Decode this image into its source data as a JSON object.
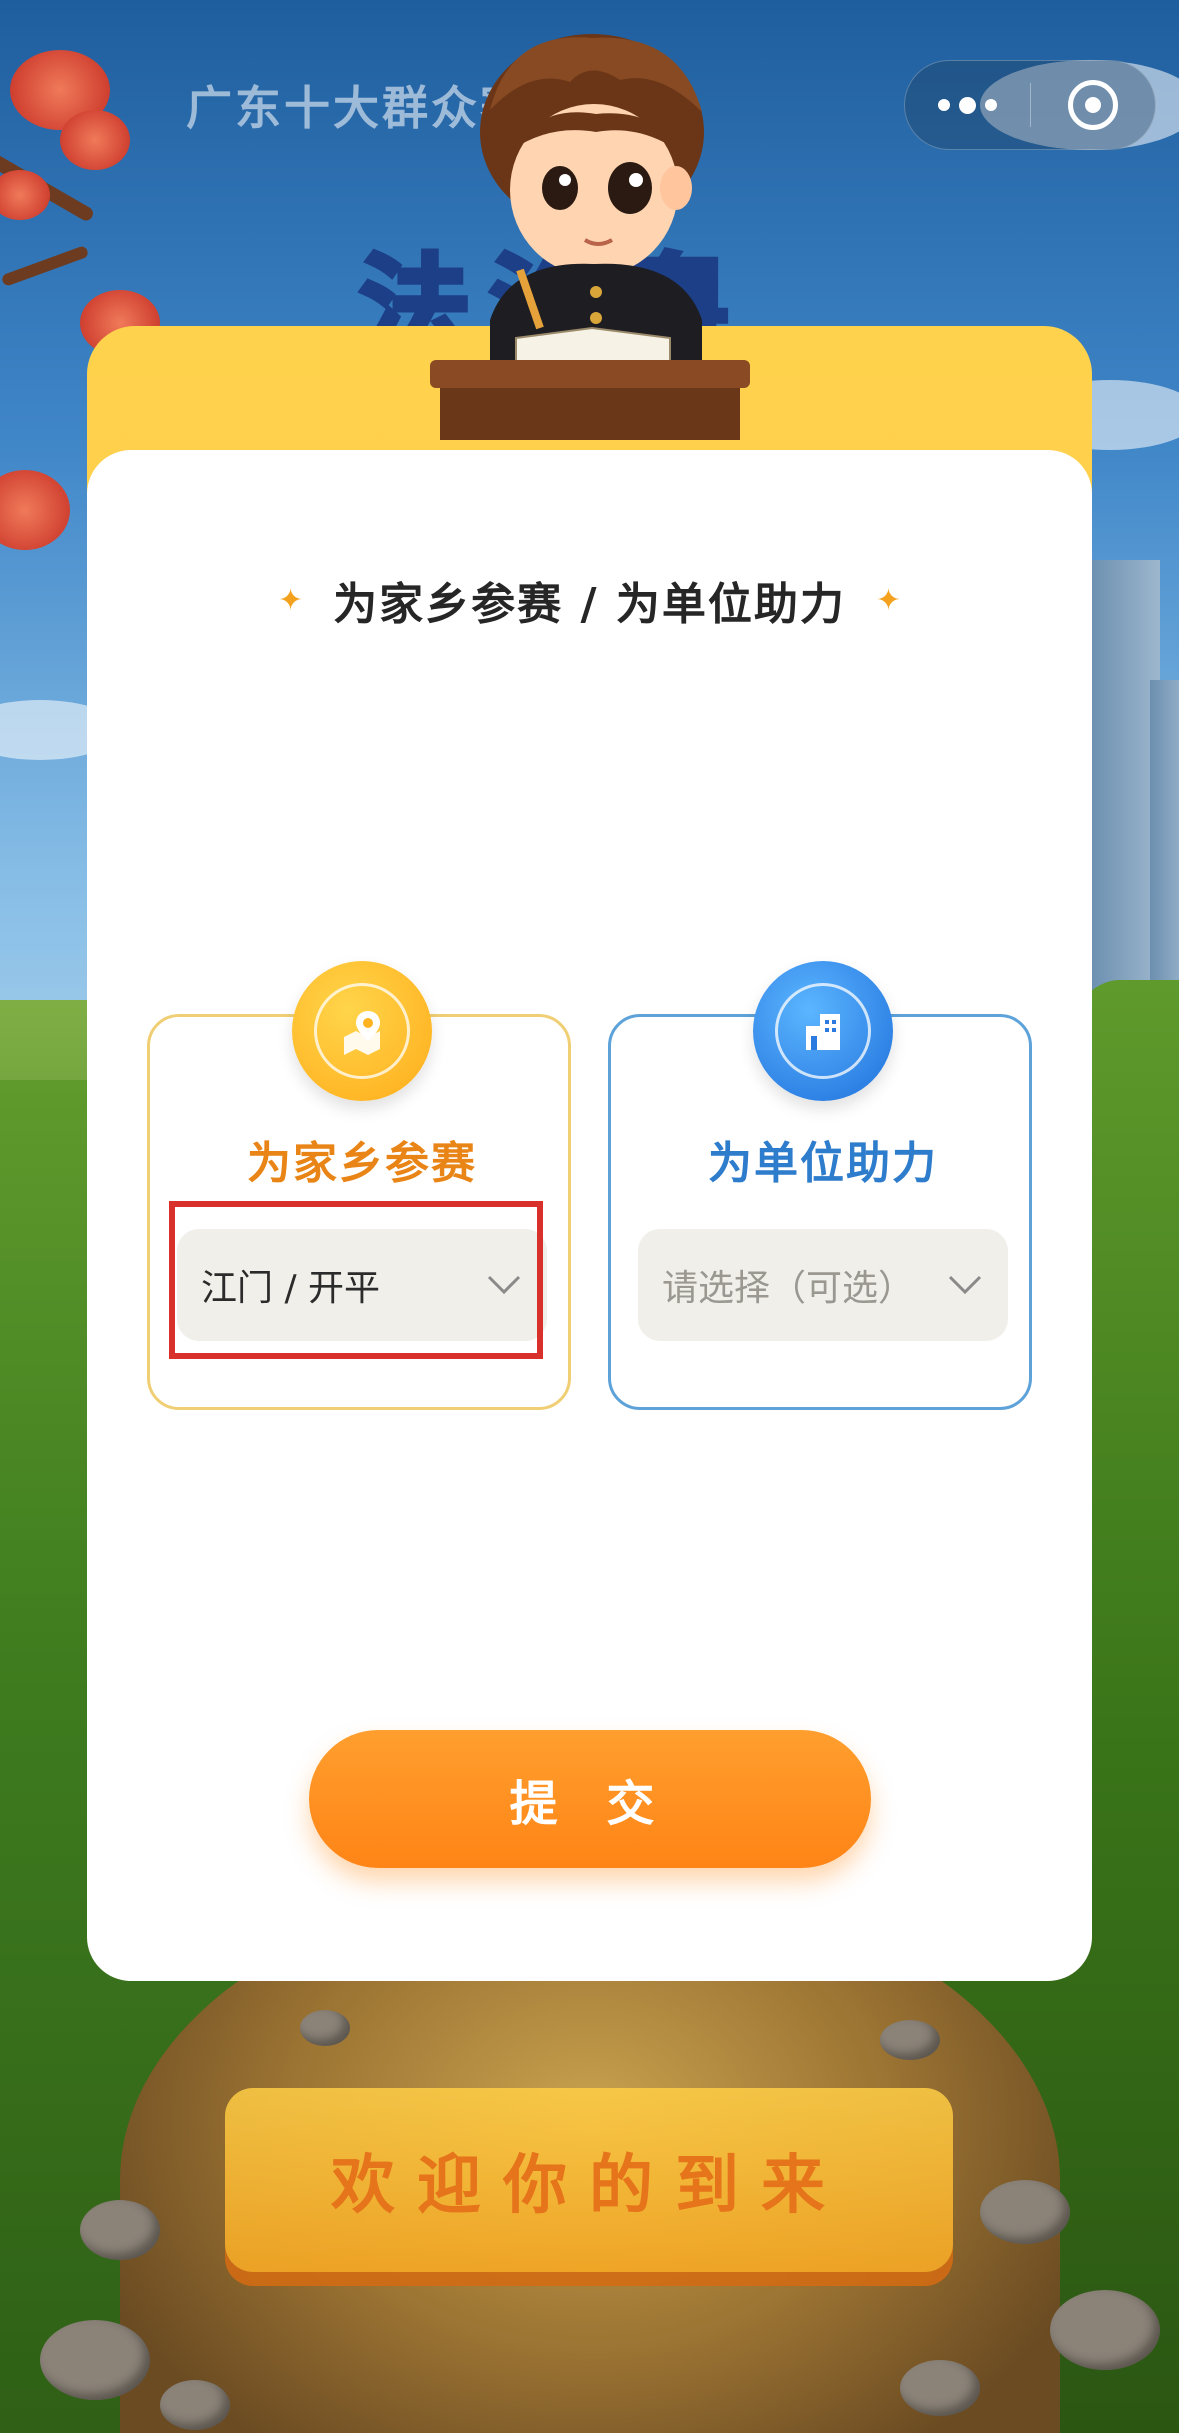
{
  "topbar": {
    "title": "广东十大群众赛",
    "more_icon": "more-dots-icon",
    "close_icon": "close-circle-icon"
  },
  "headline": "法治粤",
  "card": {
    "title": "为家乡参赛 / 为单位助力",
    "options": [
      {
        "label": "为家乡参赛",
        "icon": "map-location-icon",
        "value": "江门 / 开平",
        "color": "#e98416"
      },
      {
        "label": "为单位助力",
        "icon": "building-icon",
        "placeholder": "请选择（可选）",
        "color": "#2e7ccc"
      }
    ],
    "submit_label": "提 交"
  },
  "welcome": "欢迎你的到来",
  "colors": {
    "accent_orange": "#ff8f22",
    "accent_blue": "#2e7ccc",
    "highlight_red": "#d8312c"
  }
}
